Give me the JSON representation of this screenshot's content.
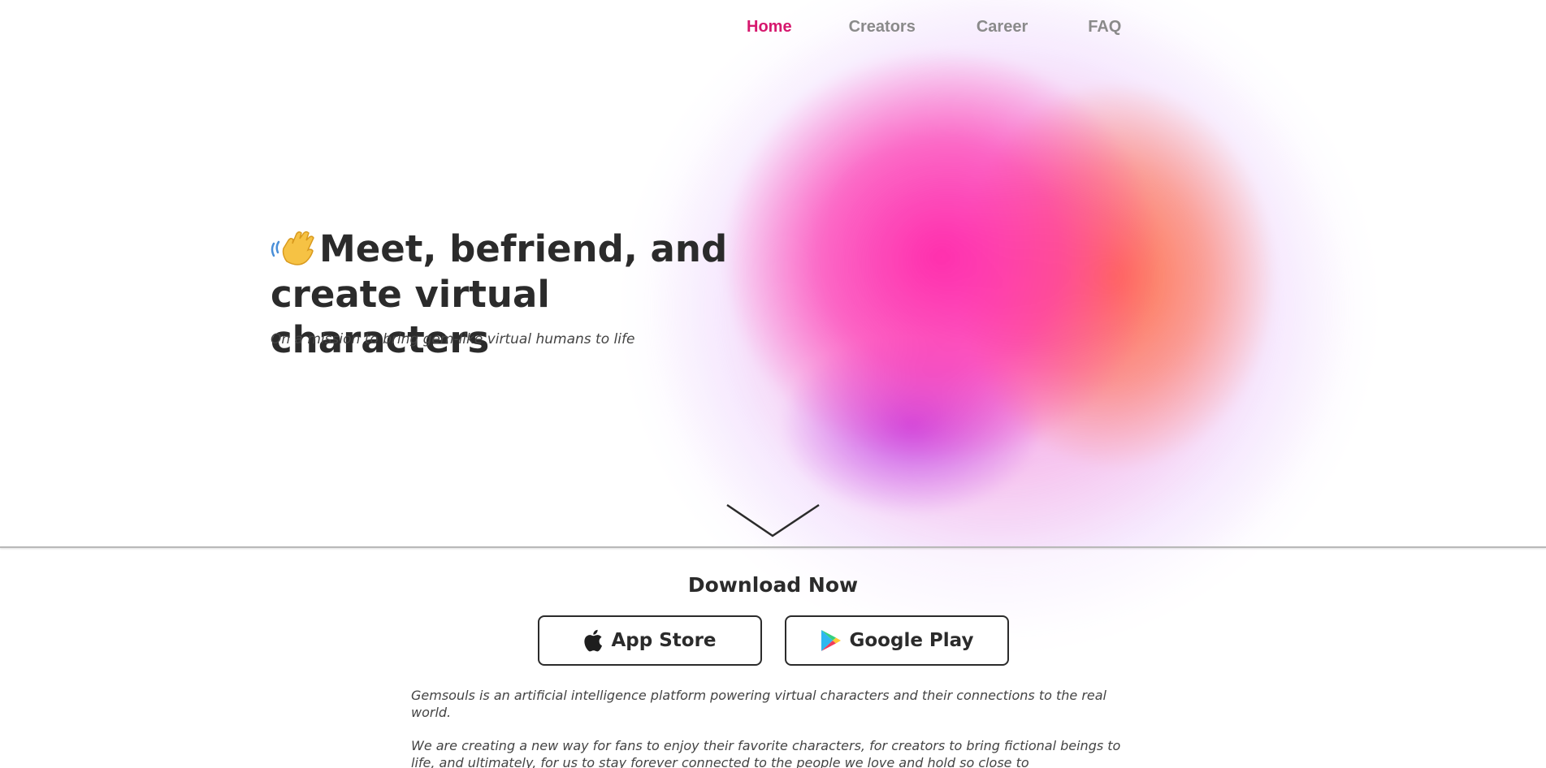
{
  "nav": {
    "items": [
      {
        "label": "Home",
        "active": true
      },
      {
        "label": "Creators",
        "active": false
      },
      {
        "label": "Career",
        "active": false
      },
      {
        "label": "FAQ",
        "active": false
      }
    ]
  },
  "hero": {
    "icon": "waving-hand-icon",
    "title_line1": "Meet, befriend, and",
    "title_line2": "create virtual characters",
    "subtitle": "On a mission to bring gem-like virtual humans to life",
    "scroll_icon": "chevron-down-icon"
  },
  "download": {
    "title": "Download Now",
    "app_store_label": "App Store",
    "app_store_icon": "apple-icon",
    "google_play_label": "Google Play",
    "google_play_icon": "google-play-icon"
  },
  "about": {
    "paragraph1": "Gemsouls is an artificial intelligence platform powering virtual characters and their connections to the real world.",
    "paragraph2": "We are creating a new way for fans to enjoy their favorite characters, for creators to bring fictional beings to life, and ultimately, for us to stay forever connected to the people we love and hold so close to"
  },
  "colors": {
    "accent": "#d6186e",
    "nav_inactive": "#8a8a8a",
    "text": "#2b2b2b"
  }
}
